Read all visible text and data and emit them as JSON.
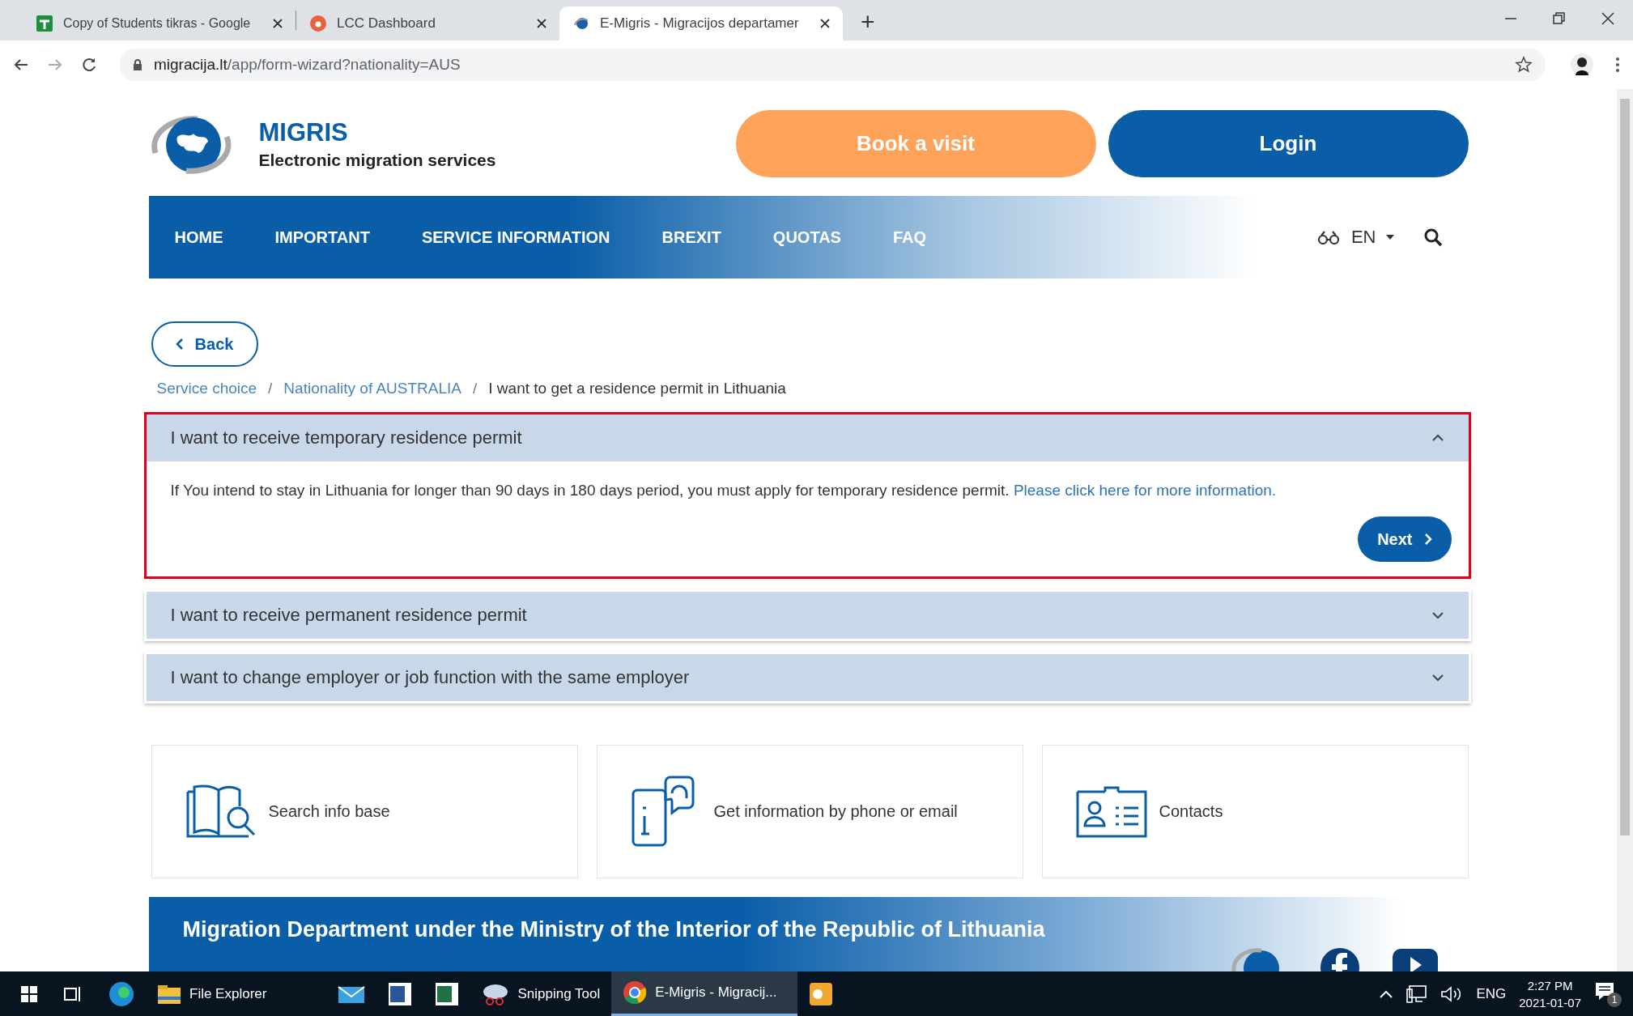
{
  "browser": {
    "tabs": [
      {
        "title": "Copy of Students tikras - Google",
        "kind": "sheets",
        "selected": false
      },
      {
        "title": "LCC Dashboard",
        "kind": "letter",
        "selected": false
      },
      {
        "title": "E-Migris - Migracijos departamer",
        "kind": "globe",
        "selected": true
      }
    ],
    "new_tab": "+",
    "url": {
      "host": "migracija.lt",
      "path": "/app/form-wizard?nationality=AUS"
    }
  },
  "header": {
    "brand": {
      "title": "MIGRIS",
      "subtitle": "Electronic migration services"
    },
    "buttons": [
      {
        "label": "Book a visit",
        "kind": "secondary"
      },
      {
        "label": "Login",
        "kind": "primary"
      }
    ]
  },
  "nav": {
    "items": [
      "HOME",
      "IMPORTANT",
      "SERVICE INFORMATION",
      "BREXIT",
      "QUOTAS",
      "FAQ"
    ],
    "language": "EN"
  },
  "back_button": "Back",
  "breadcrumb_separator": "/",
  "breadcrumb": [
    {
      "label": "Service choice",
      "link": true
    },
    {
      "label": "Nationality of AUSTRALIA",
      "link": true
    },
    {
      "label": "I want to get a residence permit in Lithuania",
      "link": false
    }
  ],
  "accordions": [
    {
      "title": "I want to receive temporary residence permit",
      "expanded": true,
      "highlighted": true,
      "text": "If You intend to stay in Lithuania for longer than 90 days in 180 days period, you must apply for temporary residence permit.",
      "link": "Please click here for more information.",
      "next_button": "Next"
    },
    {
      "title": "I want to receive permanent residence permit",
      "expanded": false,
      "highlighted": false
    },
    {
      "title": "I want to change employer or job function with the same employer",
      "expanded": false,
      "highlighted": false
    }
  ],
  "cards": [
    {
      "label": "Search info base",
      "kind": "book"
    },
    {
      "label": "Get information by phone or email",
      "kind": "phone"
    },
    {
      "label": "Contacts",
      "kind": "contacts"
    }
  ],
  "footer": {
    "title": "Migration Department under the Ministry of the Interior of the Republic of Lithuania"
  },
  "taskbar": {
    "items": [
      {
        "label": "File Explorer",
        "kind": "folder",
        "selected": false
      },
      {
        "kind": "mail",
        "selected": false
      },
      {
        "kind": "word",
        "selected": false
      },
      {
        "kind": "excel",
        "selected": false
      },
      {
        "label": "Snipping Tool",
        "kind": "snip",
        "selected": false
      },
      {
        "label": "E-Migris - Migracij...",
        "kind": "chrome",
        "selected": true
      },
      {
        "kind": "outlook",
        "selected": false
      }
    ],
    "language": "ENG",
    "time": "2:27 PM",
    "date": "2021-01-07",
    "notifications": "1"
  }
}
